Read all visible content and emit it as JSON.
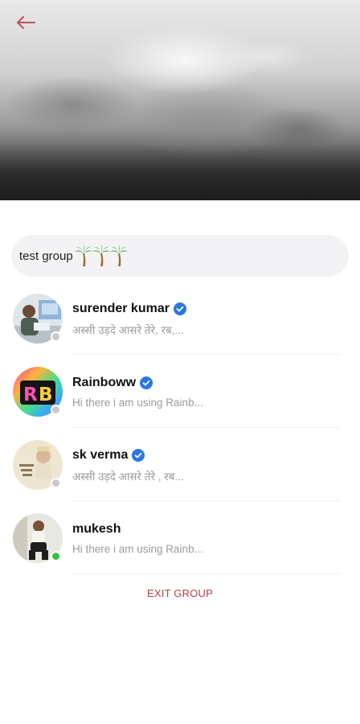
{
  "group": {
    "name": "test group",
    "emoji_icons": [
      "palm-tree-icon",
      "palm-tree-icon",
      "palm-tree-icon"
    ]
  },
  "members": [
    {
      "name": "surender kumar",
      "verified": true,
      "status": "offline",
      "message": "अस्सी उड़दे आसरे तेरे, रब,..."
    },
    {
      "name": "Rainboww",
      "verified": true,
      "status": "offline",
      "message": "Hi there i am using Rainb..."
    },
    {
      "name": "sk verma",
      "verified": true,
      "status": "offline",
      "message": "अस्सी उड़दे आसरे तेरे , रब..."
    },
    {
      "name": "mukesh",
      "verified": false,
      "status": "online",
      "message": "Hi there i am using Rainb..."
    }
  ],
  "actions": {
    "exit_label": "EXIT GROUP"
  },
  "colors": {
    "accent": "#b0414a",
    "verified": "#2b78e4",
    "online": "#3fbf3f",
    "offline": "#c9c9cd"
  }
}
